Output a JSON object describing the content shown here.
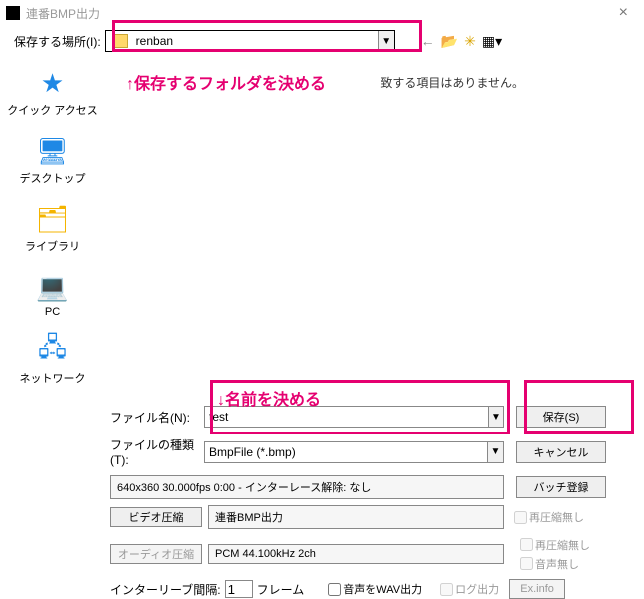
{
  "titlebar": {
    "title": "連番BMP出力"
  },
  "top": {
    "location_label": "保存する場所(I):",
    "folder_name": "renban"
  },
  "annotations": {
    "folder_hint": "↑保存するフォルダを決める",
    "name_hint": "↓名前を決める"
  },
  "sidebar": {
    "items": [
      {
        "label": "クイック アクセス"
      },
      {
        "label": "デスクトップ"
      },
      {
        "label": "ライブラリ"
      },
      {
        "label": "PC"
      },
      {
        "label": "ネットワーク"
      }
    ]
  },
  "content": {
    "empty_msg_partial": "致する項目はありません。"
  },
  "filerow": {
    "filename_label": "ファイル名(N):",
    "filename_value": "test",
    "filetype_label": "ファイルの種類(T):",
    "filetype_value": "BmpFile (*.bmp)"
  },
  "buttons": {
    "save": "保存(S)",
    "cancel": "キャンセル",
    "batch": "バッチ登録"
  },
  "info": {
    "status": "640x360  30.000fps  0:00  -  インターレース解除: なし"
  },
  "compress": {
    "video_btn": "ビデオ圧縮",
    "video_value": "連番BMP出力",
    "audio_btn": "オーディオ圧縮",
    "audio_value": "PCM 44.100kHz 2ch",
    "no_recompress": "再圧縮無し",
    "no_audio": "音声無し"
  },
  "interleave": {
    "label": "インターリーブ間隔:",
    "value": "1",
    "frame": "フレーム",
    "wav_out": "音声をWAV出力",
    "log_out": "ログ出力",
    "exinfo": "Ex.info"
  }
}
